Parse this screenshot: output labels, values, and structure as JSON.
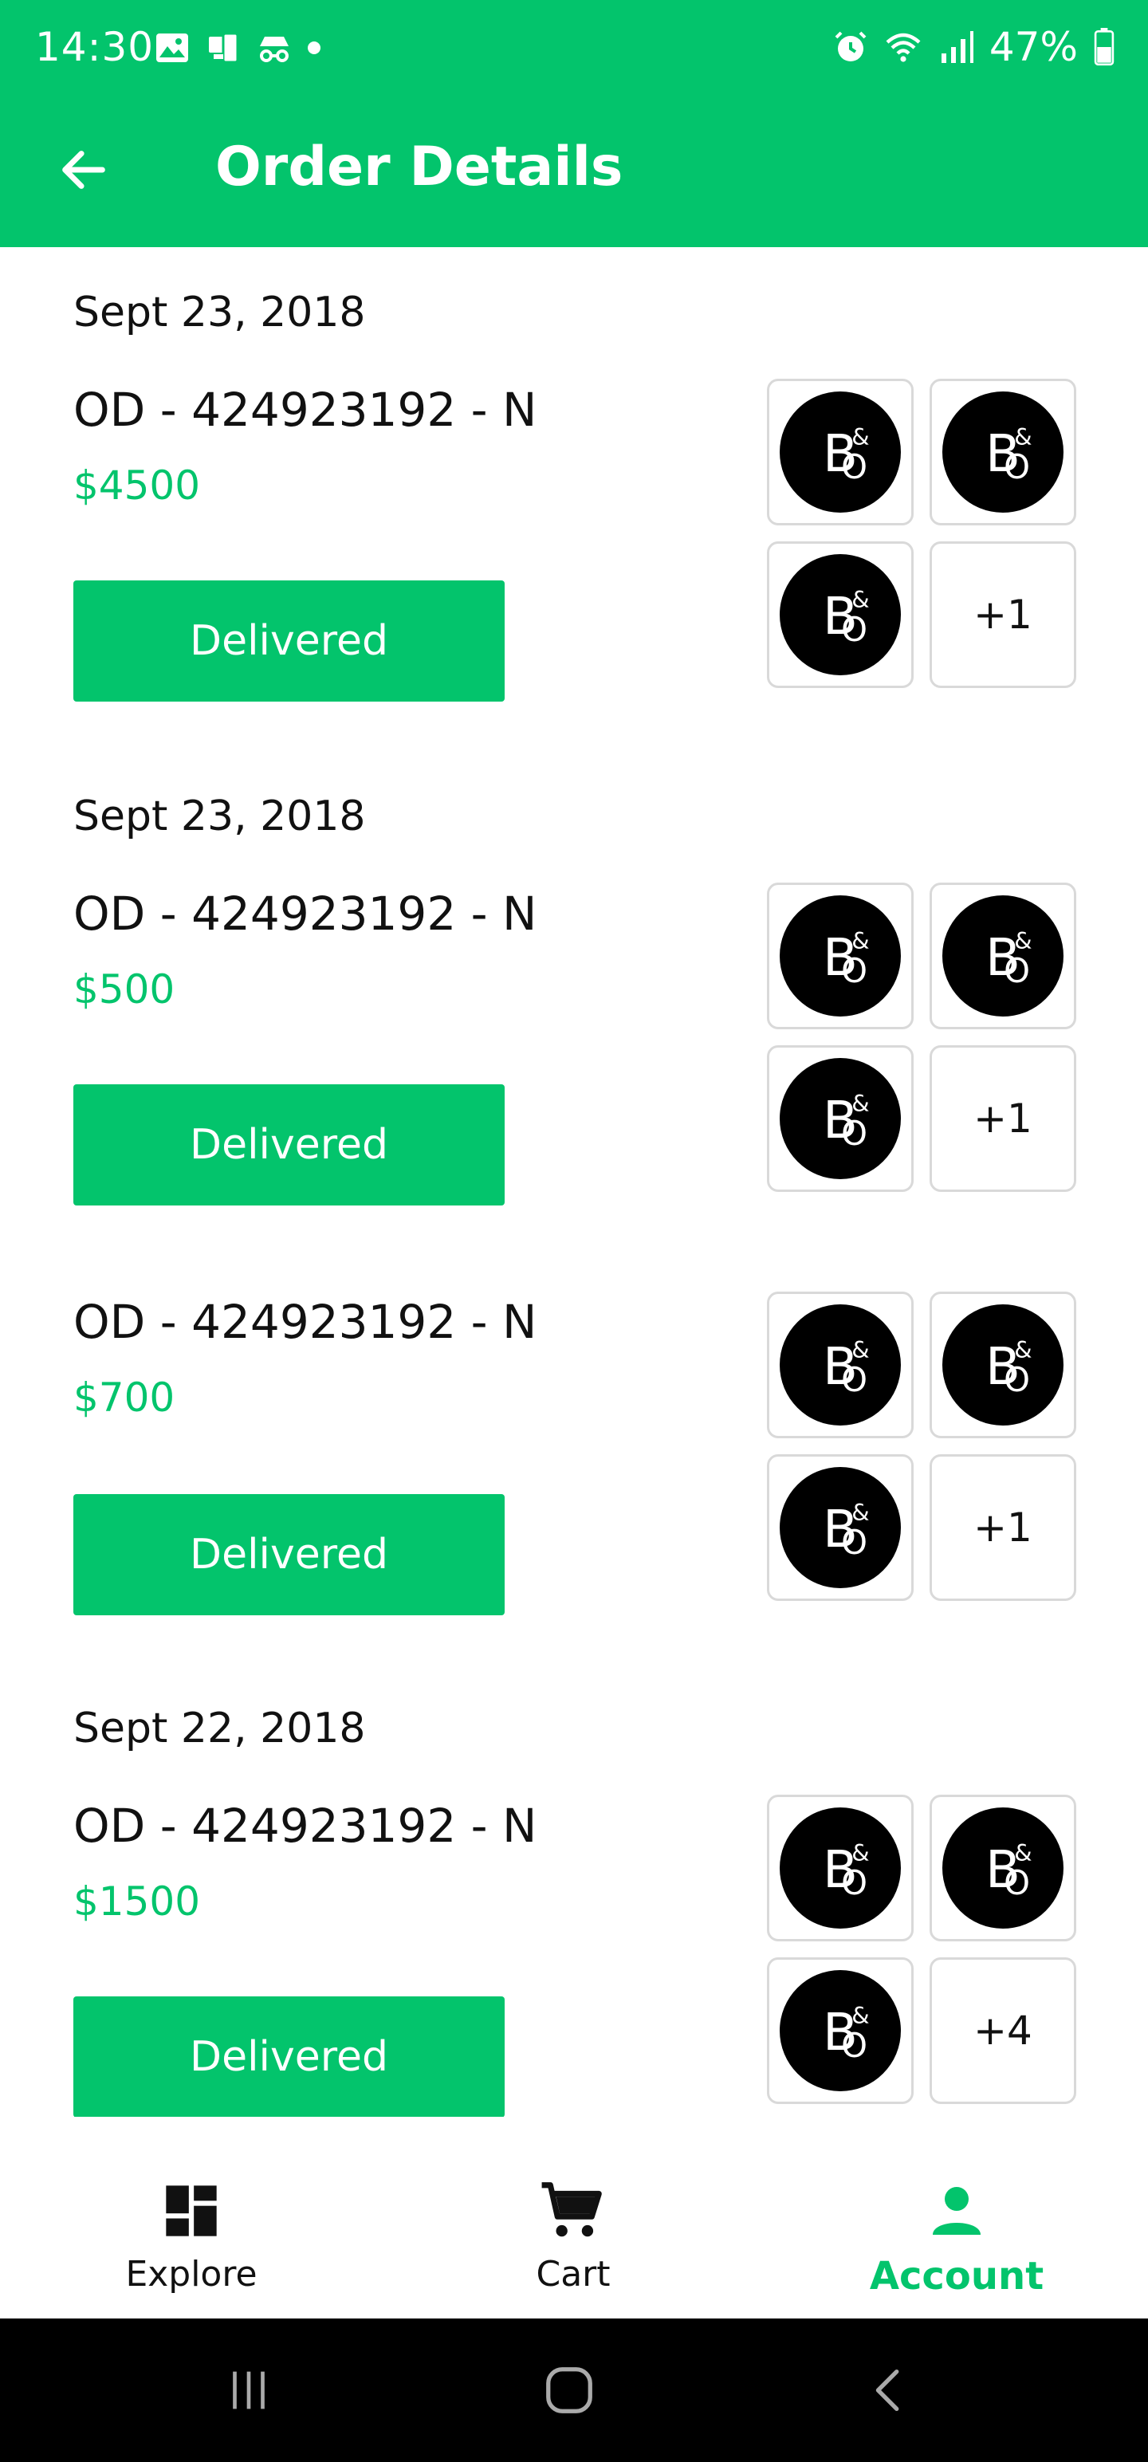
{
  "status_bar": {
    "time": "14:30",
    "battery": "47%",
    "left_icons": [
      "gallery-icon",
      "devices-icon",
      "incognito-icon",
      "dot-icon"
    ],
    "right_icons": [
      "alarm-icon",
      "wifi-icon",
      "signal-icon",
      "battery-icon"
    ]
  },
  "app_bar": {
    "title": "Order Details",
    "back_icon": "arrow-left-icon"
  },
  "orders": [
    {
      "date": "Sept 23, 2018",
      "id": "OD - 424923192 - N",
      "amount": "$4500",
      "status": "Delivered",
      "logo_text": "B&O",
      "more": "+1"
    },
    {
      "date": "Sept 23, 2018",
      "id": "OD - 424923192 - N",
      "amount": "$500",
      "status": "Delivered",
      "logo_text": "B&O",
      "more": "+1"
    },
    {
      "date": "",
      "id": "OD - 424923192 - N",
      "amount": "$700",
      "status": "Delivered",
      "logo_text": "B&O",
      "more": "+1"
    },
    {
      "date": "Sept 22, 2018",
      "id": "OD - 424923192 - N",
      "amount": "$1500",
      "status": "Delivered",
      "logo_text": "B&O",
      "more": "+4"
    }
  ],
  "bottom_nav": {
    "items": [
      {
        "label": "Explore",
        "icon": "dashboard-icon",
        "active": false
      },
      {
        "label": "Cart",
        "icon": "cart-icon",
        "active": false
      },
      {
        "label": "Account",
        "icon": "person-icon",
        "active": true
      }
    ]
  },
  "system_nav": {
    "buttons": [
      "recents-icon",
      "home-icon",
      "back-icon"
    ]
  },
  "colors": {
    "accent": "#03c46c",
    "text": "#111111",
    "thumb_border": "#d9d9d9"
  }
}
